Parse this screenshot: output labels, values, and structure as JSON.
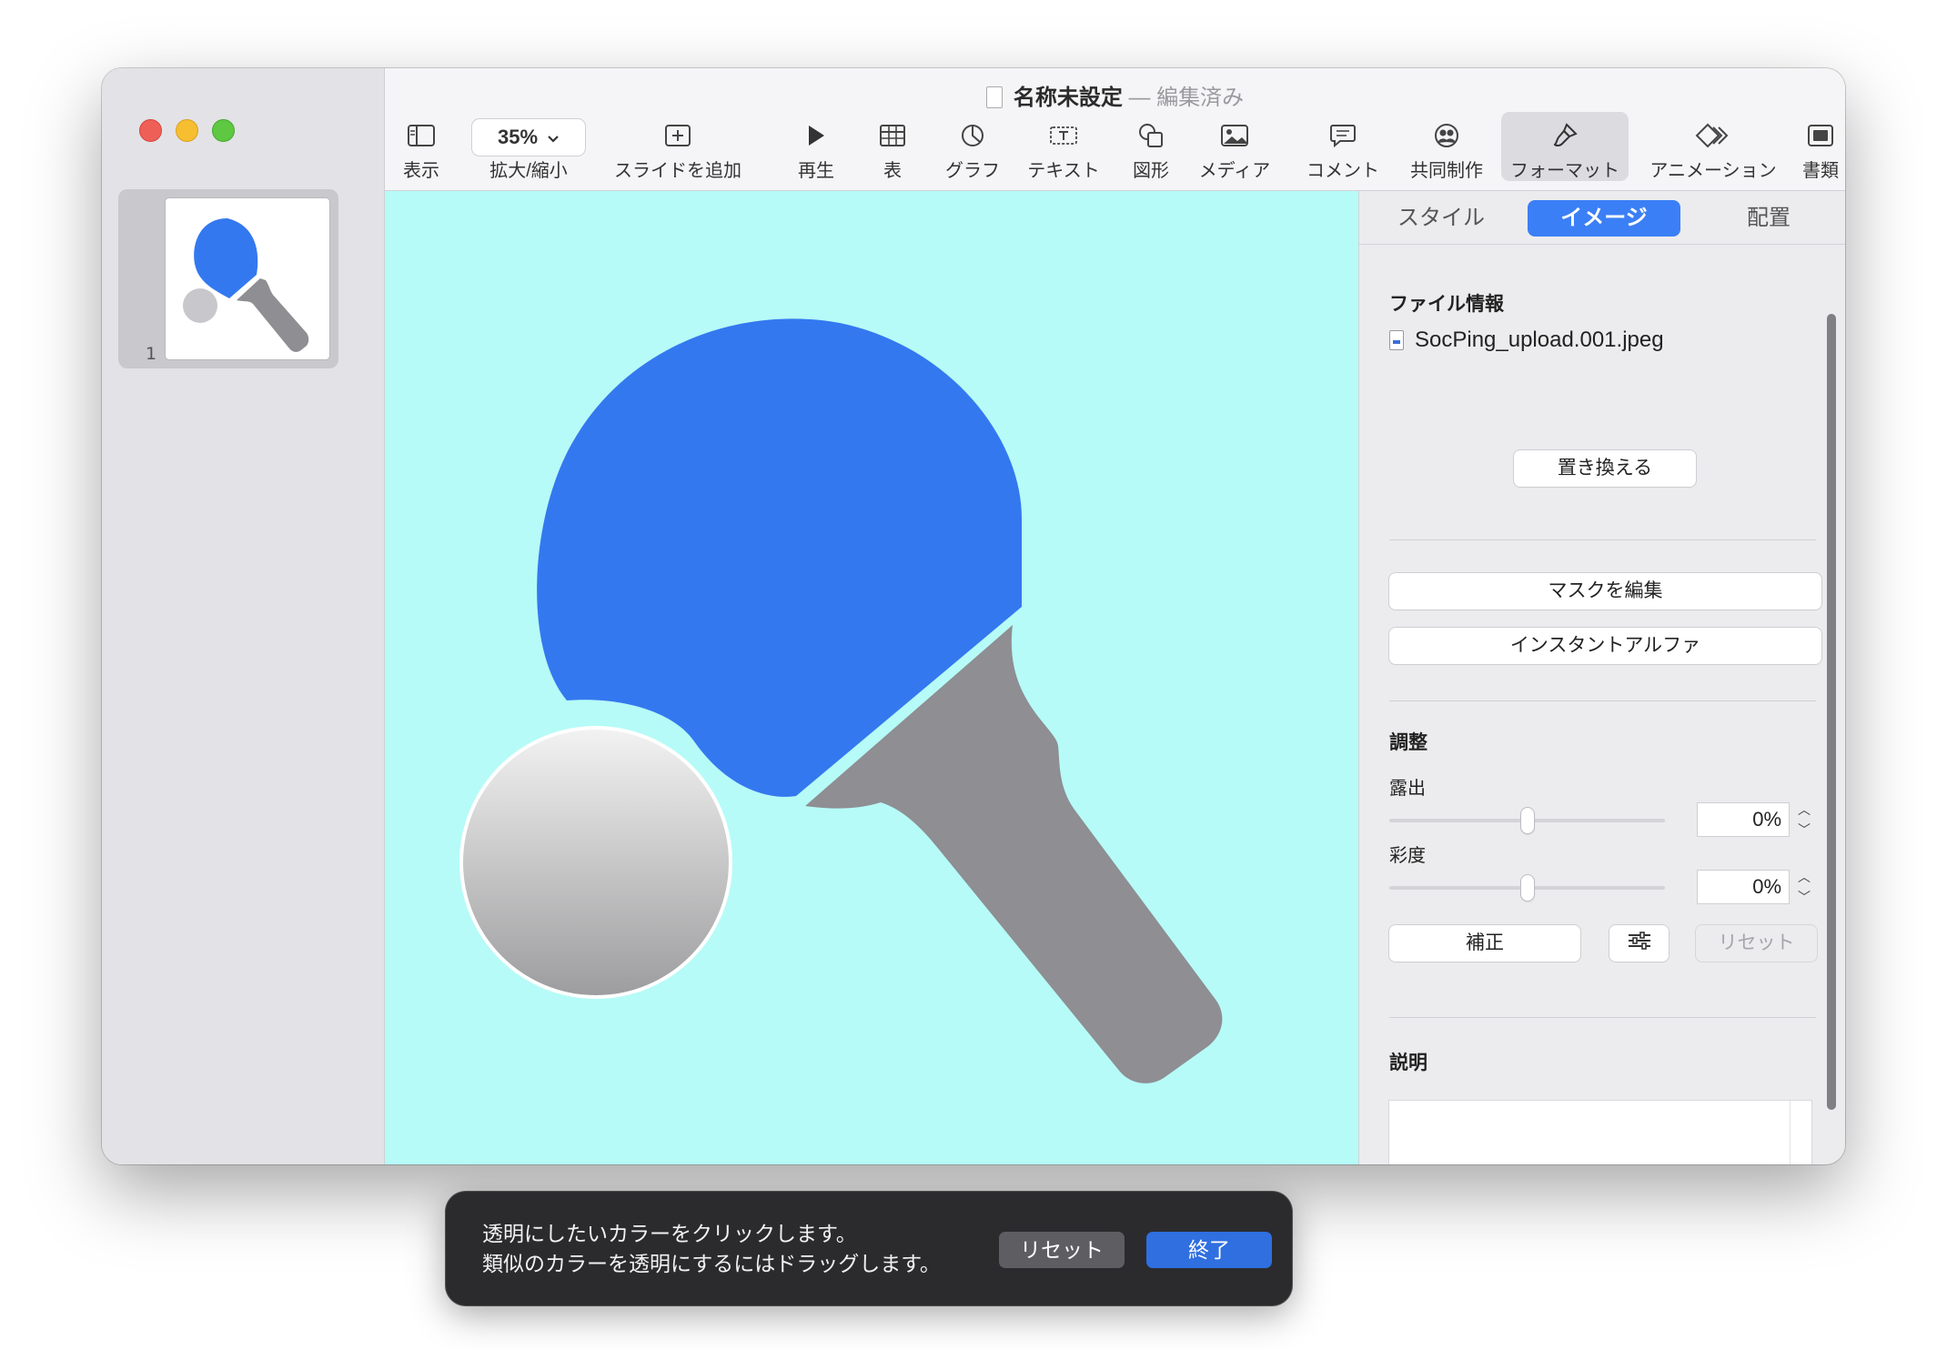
{
  "window": {
    "title": "名称未設定",
    "separator": "—",
    "status": "編集済み"
  },
  "sidebar": {
    "slides": [
      {
        "number": "1"
      }
    ]
  },
  "toolbar": {
    "view_label": "表示",
    "zoom_value": "35%",
    "zoom_label": "拡大/縮小",
    "add_slide_label": "スライドを追加",
    "play_label": "再生",
    "table_label": "表",
    "chart_label": "グラフ",
    "text_label": "テキスト",
    "shape_label": "図形",
    "media_label": "メディア",
    "comment_label": "コメント",
    "collab_label": "共同制作",
    "format_label": "フォーマット",
    "animation_label": "アニメーション",
    "document_label": "書類"
  },
  "canvas": {
    "background": "#b6fbf7",
    "paddle_head_color": "#3478f0",
    "paddle_handle_color": "#8e8e93"
  },
  "inspector": {
    "tabs": [
      {
        "label": "スタイル",
        "active": false
      },
      {
        "label": "イメージ",
        "active": true
      },
      {
        "label": "配置",
        "active": false
      }
    ],
    "file_info_title": "ファイル情報",
    "file_name": "SocPing_upload.001.jpeg",
    "replace_button": "置き換える",
    "edit_mask_button": "マスクを編集",
    "instant_alpha_button": "インスタントアルファ",
    "adjust_title": "調整",
    "exposure_label": "露出",
    "exposure_value": "0%",
    "saturation_label": "彩度",
    "saturation_value": "0%",
    "enhance_button": "補正",
    "reset_button": "リセット",
    "description_title": "説明",
    "accent_color": "#3b7ff6"
  },
  "hud": {
    "line1": "透明にしたいカラーをクリックします。",
    "line2": "類似のカラーを透明にするにはドラッグします。",
    "reset_button": "リセット",
    "done_button": "終了"
  }
}
